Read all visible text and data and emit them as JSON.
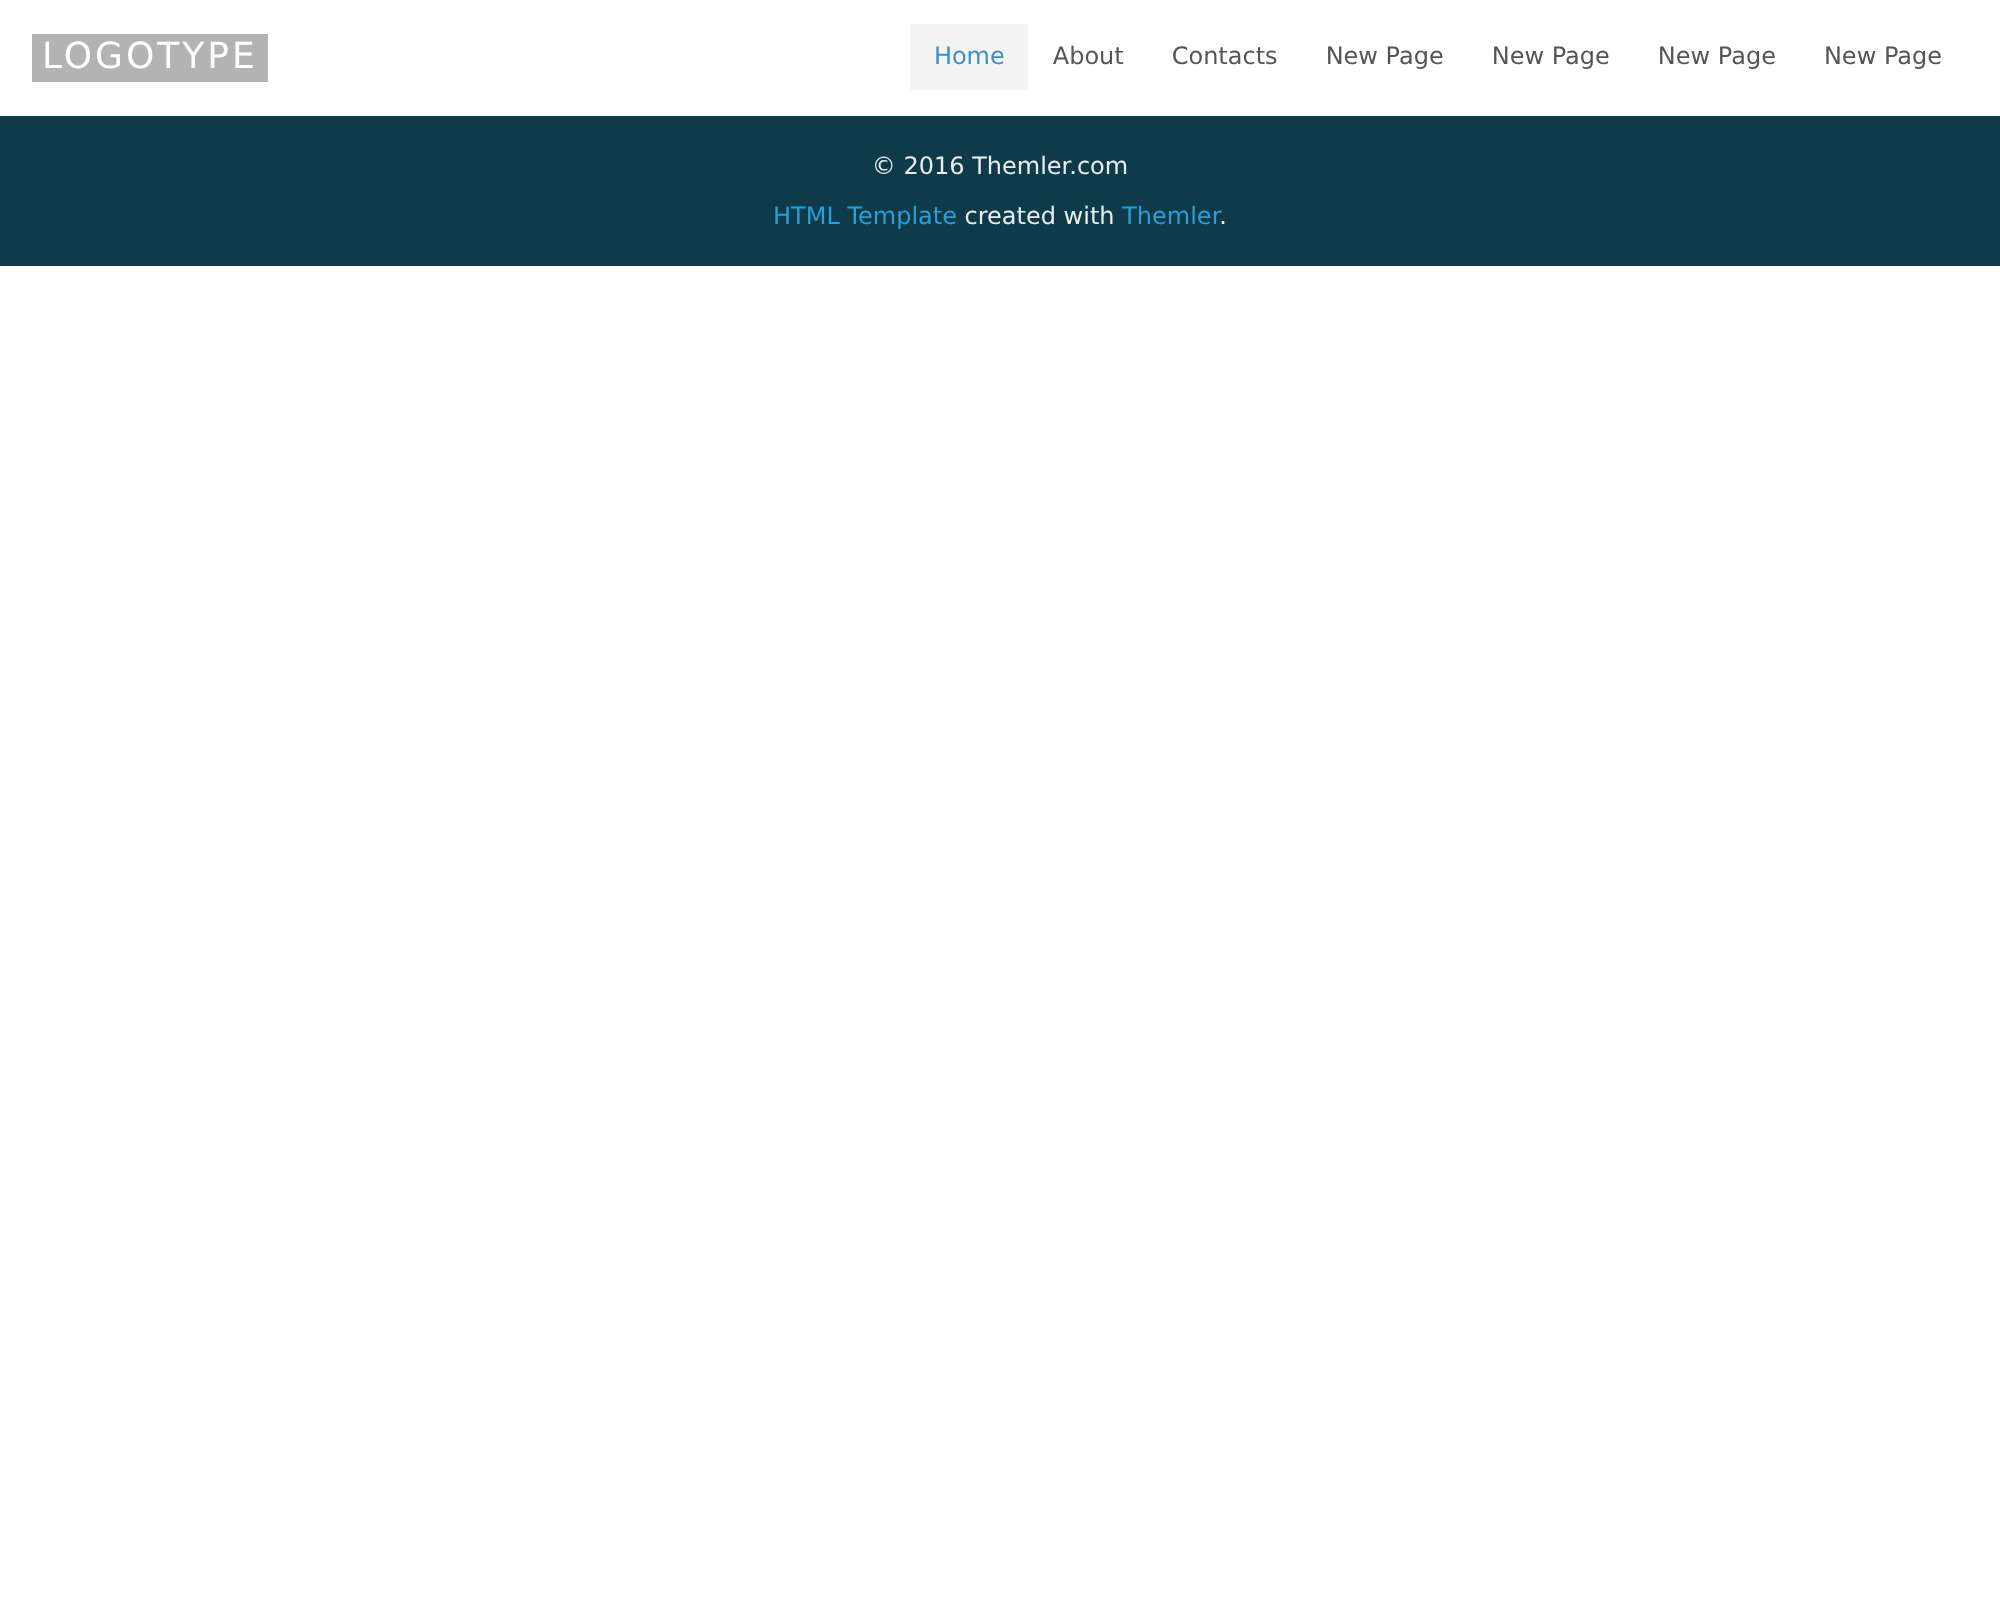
{
  "header": {
    "logo": "LOGOTYPE",
    "nav": [
      {
        "label": "Home",
        "selected": true
      },
      {
        "label": "About",
        "selected": false
      },
      {
        "label": "Contacts",
        "selected": false
      },
      {
        "label": "New Page",
        "selected": false
      },
      {
        "label": "New Page",
        "selected": false
      },
      {
        "label": "New Page",
        "selected": false
      },
      {
        "label": "New Page",
        "selected": false
      }
    ]
  },
  "footer": {
    "copyright": "© 2016 Themler.com",
    "credit": [
      {
        "kind": "link",
        "text": "HTML Template"
      },
      {
        "kind": "text",
        "text": " created with "
      },
      {
        "kind": "link",
        "text": "Themler"
      },
      {
        "kind": "text",
        "text": "."
      }
    ]
  }
}
